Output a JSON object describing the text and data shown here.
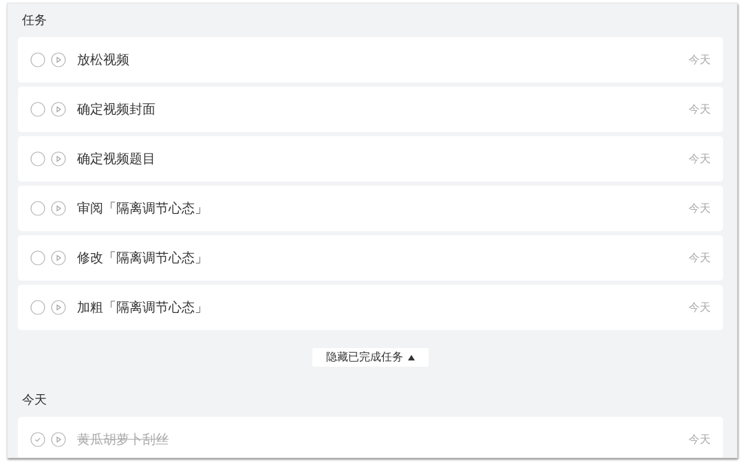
{
  "sections": [
    {
      "heading": "任务",
      "tasks": [
        {
          "title": "放松视频",
          "done": false,
          "date": "今天"
        },
        {
          "title": "确定视频封面",
          "done": false,
          "date": "今天"
        },
        {
          "title": "确定视频题目",
          "done": false,
          "date": "今天"
        },
        {
          "title": "审阅「隔离调节心态」",
          "done": false,
          "date": "今天"
        },
        {
          "title": "修改「隔离调节心态」",
          "done": false,
          "date": "今天"
        },
        {
          "title": "加粗「隔离调节心态」",
          "done": false,
          "date": "今天"
        }
      ],
      "footer_button": {
        "label": "隐藏已完成任务",
        "expanded": true
      }
    },
    {
      "heading": "今天",
      "tasks": [
        {
          "title": "黄瓜胡萝卜刮丝",
          "done": true,
          "date": "今天"
        }
      ]
    }
  ]
}
